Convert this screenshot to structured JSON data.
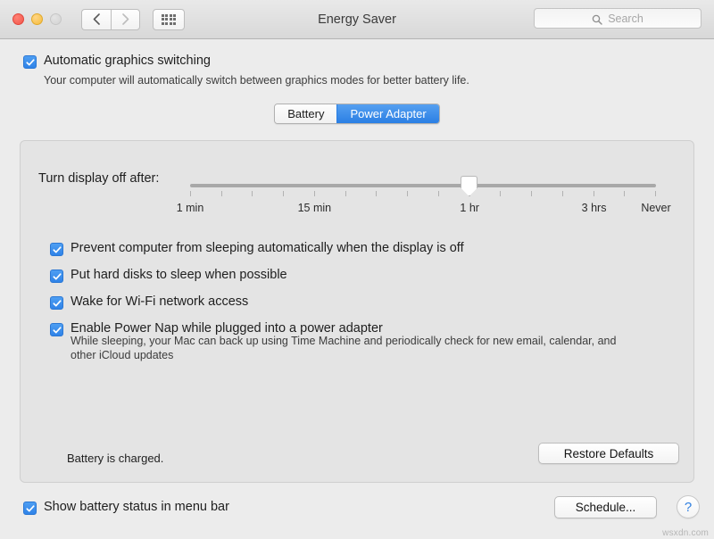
{
  "window": {
    "title": "Energy Saver",
    "traffic_lights": [
      "close-red",
      "minimize-yellow",
      "zoom-disabled-gray"
    ],
    "nav": {
      "back_icon": "chevron-left-icon",
      "forward_icon": "chevron-right-icon",
      "grid_icon": "show-all-grid-icon"
    },
    "search": {
      "placeholder": "Search",
      "icon": "search-icon",
      "value": ""
    }
  },
  "auto_graphics": {
    "label": "Automatic graphics switching",
    "checked": true,
    "description": "Your computer will automatically switch between graphics modes for better battery life."
  },
  "tabs": [
    {
      "label": "Battery",
      "active": false
    },
    {
      "label": "Power Adapter",
      "active": true
    }
  ],
  "slider": {
    "label": "Turn display off after:",
    "value_label": "1 hr",
    "tick_count": 16,
    "thumb_index": 9,
    "tick_labels": [
      {
        "text": "1 min",
        "percent": 0
      },
      {
        "text": "15 min",
        "percent": 26.7
      },
      {
        "text": "1 hr",
        "percent": 60.0
      },
      {
        "text": "3 hrs",
        "percent": 86.7
      },
      {
        "text": "Never",
        "percent": 100
      }
    ]
  },
  "options": [
    {
      "label": "Prevent computer from sleeping automatically when the display is off",
      "checked": true
    },
    {
      "label": "Put hard disks to sleep when possible",
      "checked": true
    },
    {
      "label": "Wake for Wi-Fi network access",
      "checked": true
    },
    {
      "label": "Enable Power Nap while plugged into a power adapter",
      "checked": true
    }
  ],
  "power_nap_note": "While sleeping, your Mac can back up using Time Machine and periodically check for new email, calendar, and other iCloud updates",
  "battery_status": "Battery is charged.",
  "restore_defaults_label": "Restore Defaults",
  "footer": {
    "show_battery_label": "Show battery status in menu bar",
    "show_battery_checked": true,
    "schedule_label": "Schedule...",
    "help_label": "?"
  },
  "watermark": "wsxdn.com",
  "colors": {
    "accent_blue": "#2f83e8",
    "tab_active_blue": "#2a7fe4",
    "window_bg": "#ececec",
    "panel_bg": "#e4e4e4"
  }
}
